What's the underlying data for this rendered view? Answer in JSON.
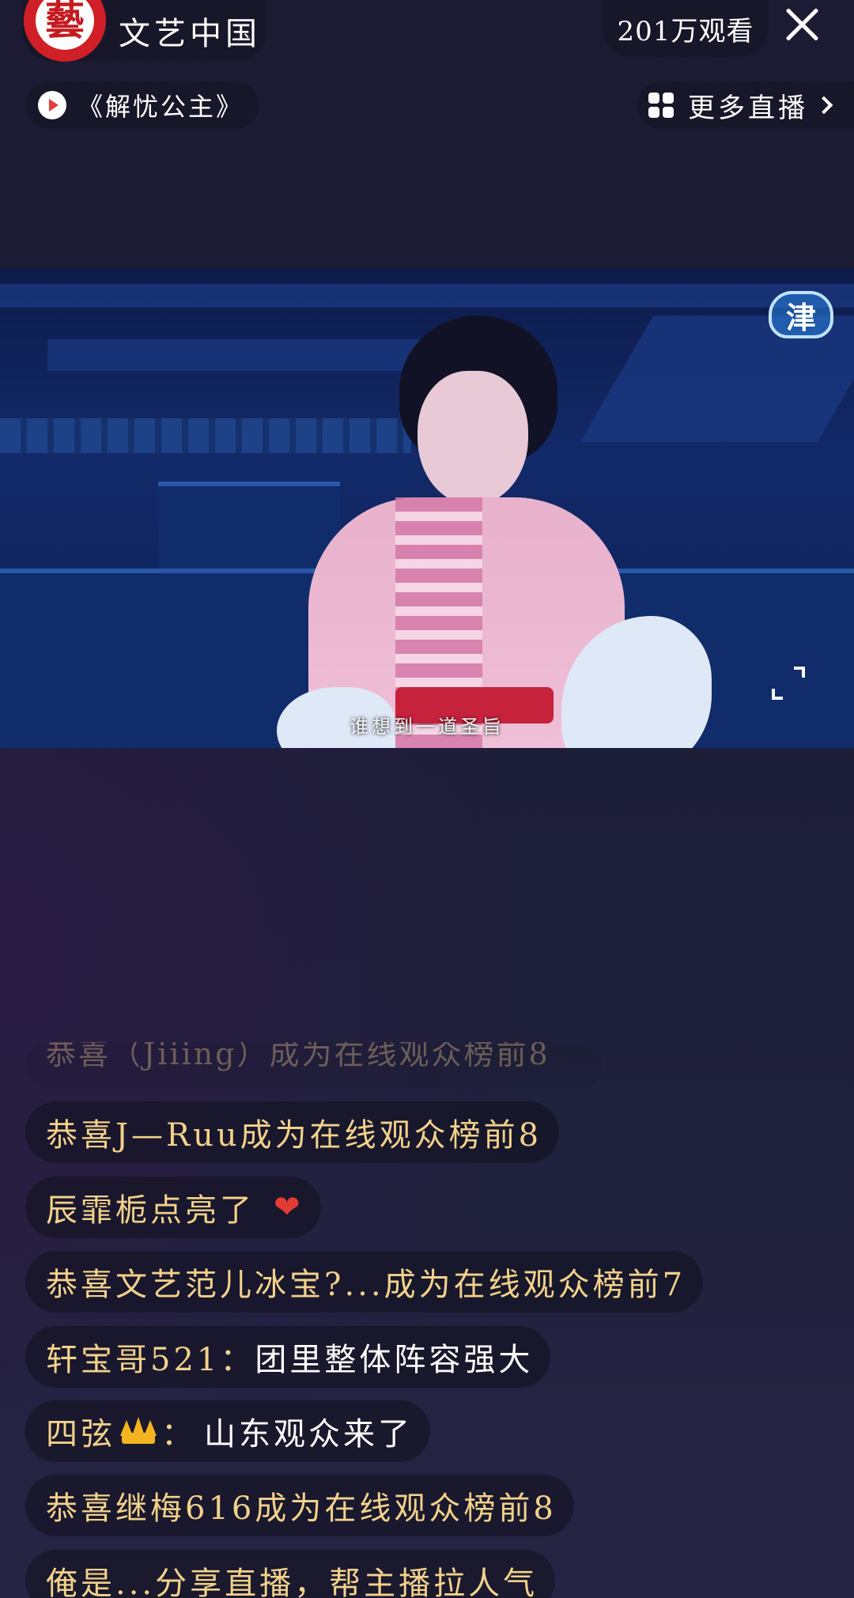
{
  "header": {
    "logo_text": "藝",
    "channel_name": "文艺中国",
    "viewer_count": "201万观看",
    "close_icon": "close-icon"
  },
  "program": {
    "title": "《解忧公主》",
    "icon": "play-icon"
  },
  "more_live": {
    "label": "更多直播",
    "icon": "grid-icon"
  },
  "video": {
    "watermark": "津",
    "subtitle": "谁想到一道圣旨",
    "fullscreen_icon": "fullscreen-icon"
  },
  "chat": {
    "faded_message": "恭喜（Jiiing）成为在线观众榜前8",
    "messages": [
      {
        "user": "",
        "text": "恭喜J—Ruu成为在线观众榜前8"
      },
      {
        "user": "",
        "text": "辰霏栀点亮了"
      },
      {
        "user": "",
        "text": "恭喜文艺范儿冰宝?...成为在线观众榜前7"
      },
      {
        "user": "轩宝哥521：",
        "text": "团里整体阵容强大"
      },
      {
        "user": "四弦",
        "sep": "：",
        "text": "山东观众来了"
      },
      {
        "user": "",
        "text": "恭喜继梅616成为在线观众榜前8"
      },
      {
        "user": "俺是...分享直播，帮主播拉人气",
        "text": ""
      }
    ]
  },
  "colors": {
    "gold_text": "#f2d18a",
    "heart": "#e23b33",
    "logo_red": "#d01f27"
  }
}
